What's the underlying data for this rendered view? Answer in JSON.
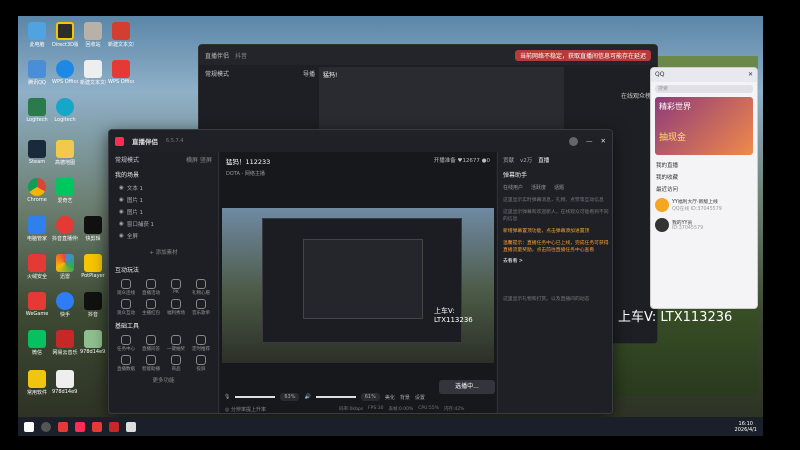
{
  "desktop": {
    "icons": [
      "此电脑",
      "Direct3D版",
      "回收站",
      "新建文本文档",
      "腾讯QQ",
      "WPS Office",
      "Logitech",
      "Steam",
      "Chrome",
      "爱奇艺",
      "高德地图",
      "快剪辑",
      "电脑管家",
      "抖音直播伴侣",
      "PotPlayer",
      "火绒安全",
      "迅雷",
      "酷狗音乐",
      "WeGame",
      "快手",
      "抖音",
      "微信",
      "网易云音乐",
      "常用软件",
      "978d14e9..."
    ]
  },
  "bg_window": {
    "title": "直播伴侣",
    "tab": "抖音",
    "mode": "常规模式",
    "switch_label": "导播",
    "toast": "当前网络不稳定，获取直播间信息可能存在延迟",
    "right_title": "在线观众榜",
    "room": "猛犸!"
  },
  "main": {
    "title": "直播伴侣",
    "version": "6.5.7.4",
    "room_title": "猛犸！112233",
    "category": "DOTA - 网络主播",
    "status": "开播准备",
    "stats": {
      "fans": "12677",
      "audience": "0"
    },
    "left": {
      "mode": "常规模式",
      "mode_tags": [
        "横屏",
        "竖屏"
      ],
      "scenes_title": "我的场景",
      "scene_items": [
        "文本 1",
        "图片 1",
        "图片 1",
        "窗口捕获 1",
        "全屏"
      ],
      "add_source": "+ 添加素材",
      "interact_title": "互动玩法",
      "interact_items": [
        "观众连线",
        "直播活动",
        "PK",
        "礼物心愿",
        "观众互动",
        "主播红包",
        "福利秀场",
        "音乐歌单"
      ],
      "tools_title": "基础工具",
      "tools_items": [
        "任务中心",
        "直播问答",
        "一键抽奖",
        "定时推荐",
        "直播数据",
        "智能助播",
        "商品",
        "投屏"
      ],
      "more": "更多功能"
    },
    "controls": {
      "mic_label": "麦克风",
      "mic_vol": "63%",
      "spk_label": "扬声器",
      "spk_vol": "61%",
      "btn1": "美化",
      "btn2": "背景",
      "btn3": "设置",
      "start_button": "选播中..."
    },
    "status_bar": [
      "码率:0kbps",
      "FPS:30",
      "丢帧:0.00%",
      "CPU:55%",
      "内存:42%"
    ],
    "bottom_left": "◎ 分辨率提上升率",
    "right": {
      "tabs": [
        "贡献",
        "v2万",
        "直播"
      ],
      "head": "弹幕助手",
      "subtabs": [
        "在线用户",
        "活跃度",
        "话题"
      ],
      "tips": [
        "这里显示实时弹幕消息，礼物、点赞等互动信息",
        "这里显示弹幕和欢迎新人，在线观众可能看到不同的信息",
        "新增弹幕置顶功能，点击弹幕添加进置顶",
        "温馨提示：直播任务中心已上线，完成任务可获得直播流量奖励，点击前往直播任务中心查看"
      ],
      "link": "去看看 >",
      "footer": "这里显示礼物和打赏。以及直播间的动态"
    }
  },
  "qq": {
    "title": "QQ",
    "search": "搜索",
    "banner": "精彩世界",
    "banner_sub": "抽现金",
    "items": [
      "我的直播",
      "我的收藏",
      "最近访问"
    ],
    "chat_name": "YY福利大厅·新版上线",
    "chat_msg": "QQ在线 ID:37045579",
    "contact": "我的YY员",
    "contact_id": "ID:37045579"
  },
  "overlay": "上车V:   LTX113236",
  "taskbar": {
    "time": "16:10",
    "date": "2026/4/1"
  }
}
